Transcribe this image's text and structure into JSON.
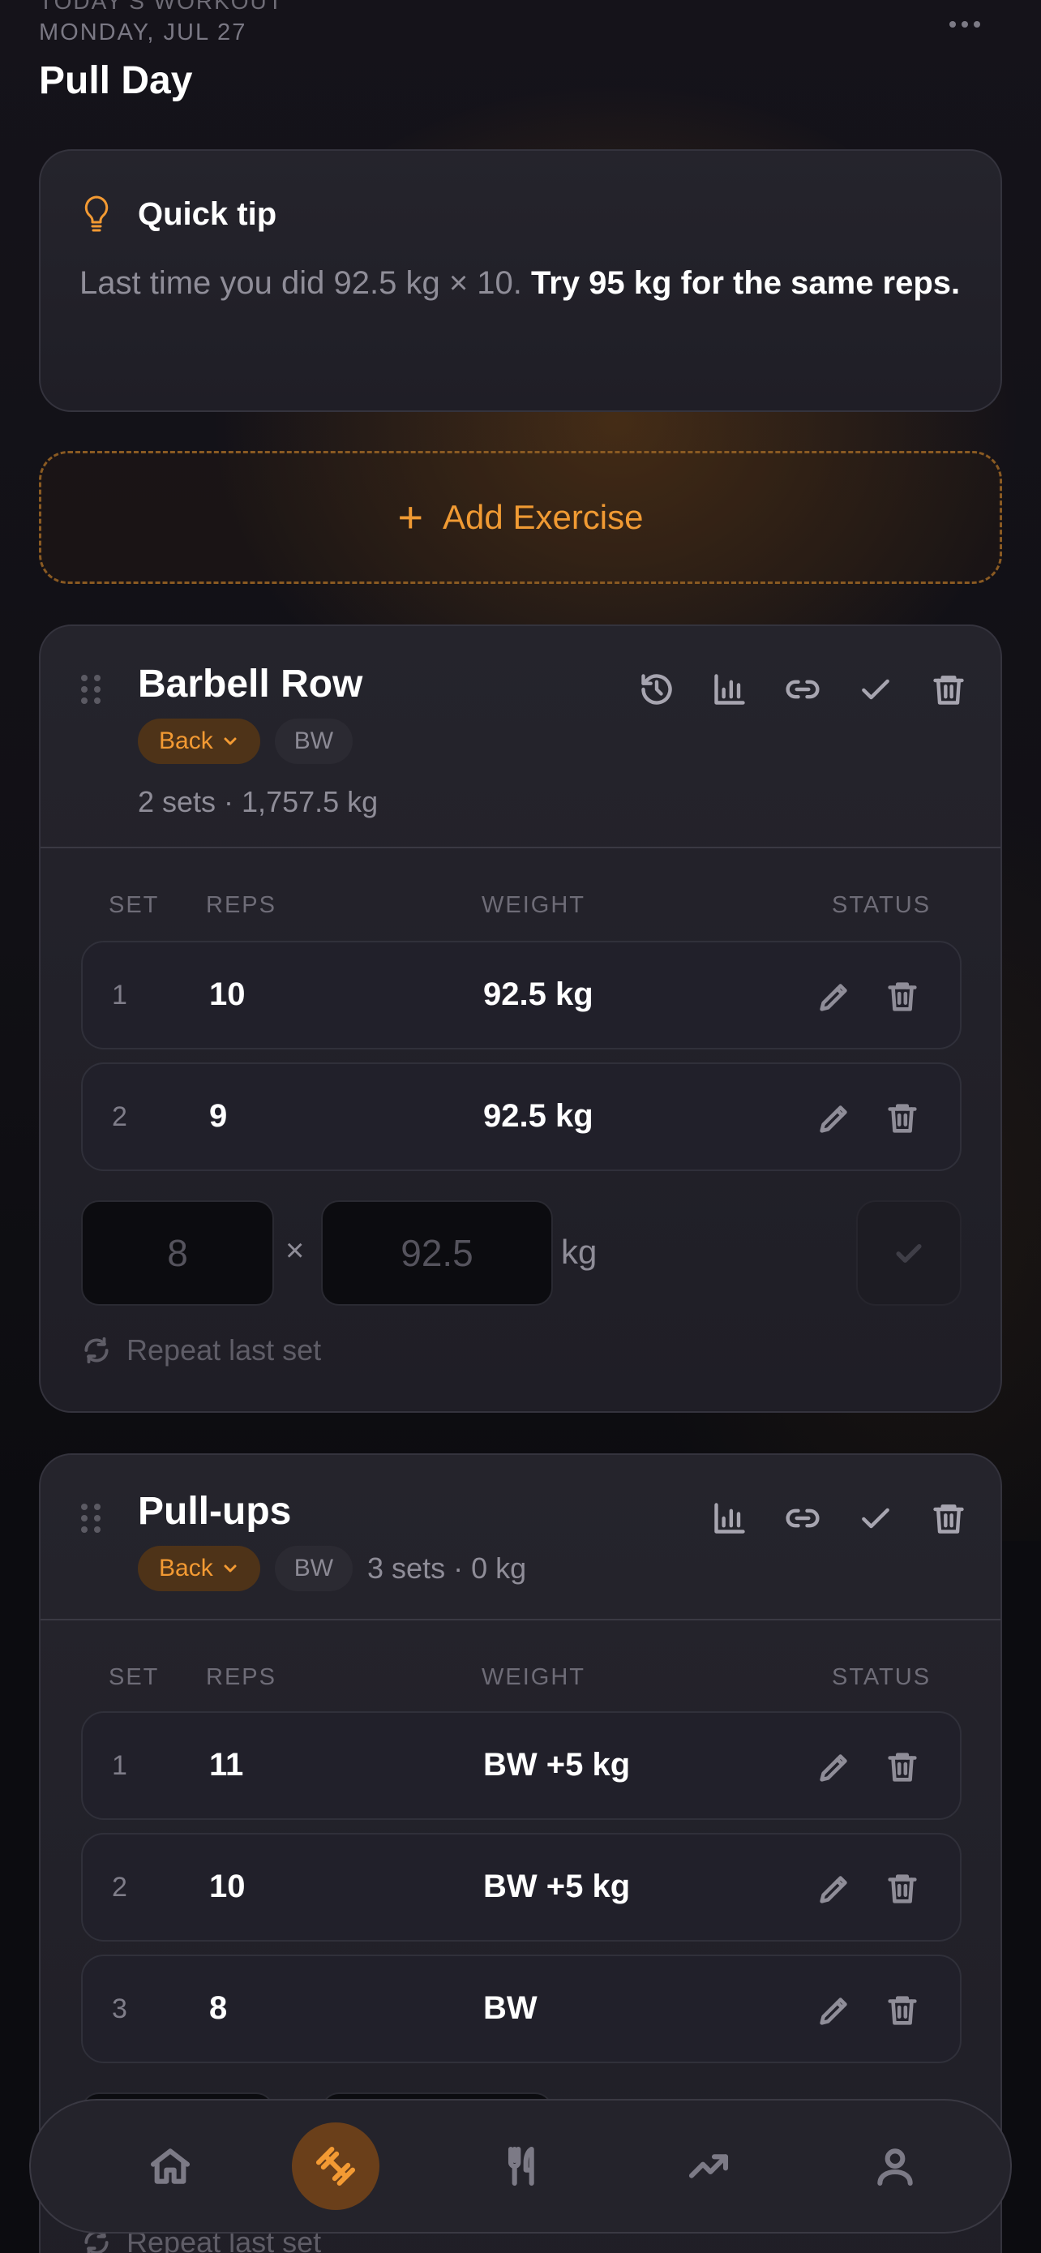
{
  "header": {
    "eyebrow": "TODAY'S WORKOUT",
    "date": "MONDAY, JUL 27",
    "title": "Pull Day"
  },
  "tip": {
    "title": "Quick tip",
    "text_muted": "Last time you did 92.5 kg × 10.",
    "text_strong": "Try 95 kg for the same reps.",
    "icon": "lightbulb-icon"
  },
  "add_exercise": {
    "label": "Add Exercise",
    "plus": "+"
  },
  "table_headers": {
    "set": "SET",
    "reps": "REPS",
    "weight": "WEIGHT",
    "status": "STATUS"
  },
  "exercises": [
    {
      "name": "Barbell Row",
      "muscle": "Back",
      "tag": "BW",
      "summary": "2 sets · 1,757.5 kg",
      "sets": [
        {
          "set": "1",
          "reps": "10",
          "weight": "92.5 kg"
        },
        {
          "set": "2",
          "reps": "9",
          "weight": "92.5 kg"
        }
      ],
      "input": {
        "reps_placeholder": "8",
        "times": "×",
        "weight_placeholder": "92.5",
        "unit": "kg"
      },
      "repeat_label": "Repeat last set"
    },
    {
      "name": "Pull-ups",
      "muscle": "Back",
      "tag": "BW",
      "summary": "3 sets · 0 kg",
      "sets": [
        {
          "set": "1",
          "reps": "11",
          "weight": "BW +5 kg"
        },
        {
          "set": "2",
          "reps": "10",
          "weight": "BW +5 kg"
        },
        {
          "set": "3",
          "reps": "8",
          "weight": "BW"
        }
      ],
      "repeat_label": "Repeat last set"
    }
  ],
  "nav": {
    "items": [
      "home-icon",
      "workout-icon",
      "nutrition-icon",
      "progress-icon",
      "profile-icon"
    ],
    "active": "workout-icon"
  },
  "colors": {
    "accent": "#f39a33",
    "background": "#0c0c10",
    "card": "#22212a"
  }
}
